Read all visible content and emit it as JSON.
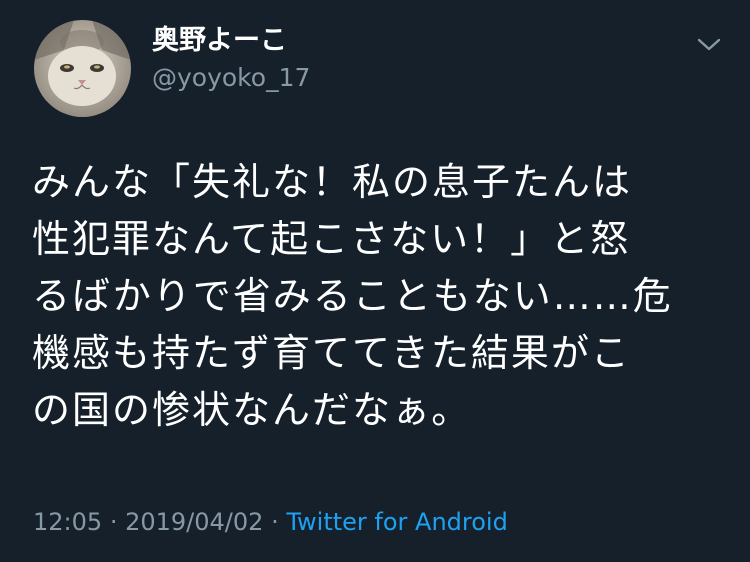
{
  "author": {
    "display_name": "奥野よーこ",
    "handle": "@yoyoko_17",
    "avatar_icon": "cat-avatar"
  },
  "menu_icon": "chevron-down-icon",
  "tweet": {
    "text": "みんな「失礼な！私の息子たんは\n性犯罪なんて起こさない！」と怒\nるばかりで省みることもない……危\n機感も持たず育ててきた結果がこ\nの国の惨状なんだなぁ。"
  },
  "meta": {
    "time": "12:05",
    "separator": "·",
    "date": "2019/04/02",
    "source": "Twitter for Android"
  },
  "colors": {
    "background": "#15202b",
    "text": "#ffffff",
    "secondary": "#8899a6",
    "link": "#1da1f2"
  }
}
